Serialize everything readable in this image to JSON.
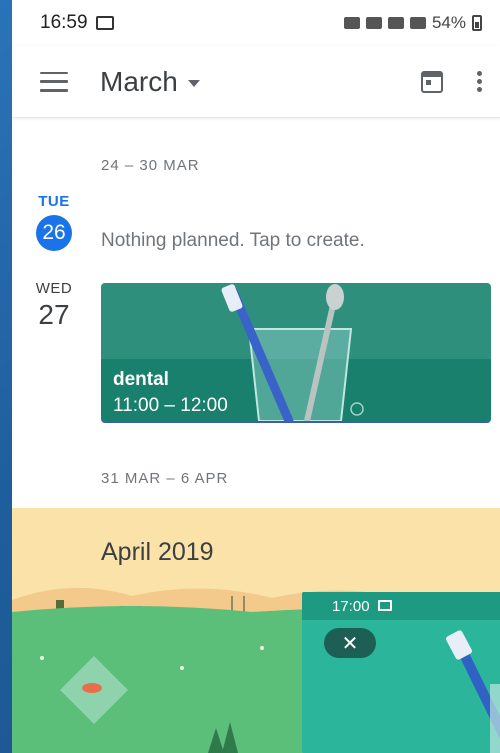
{
  "status_bar": {
    "time": "16:59",
    "battery": "54%"
  },
  "app_bar": {
    "month": "March"
  },
  "schedule": {
    "week1_label": "24 – 30 MAR",
    "days": [
      {
        "name": "TUE",
        "number": "26",
        "today": true,
        "message": "Nothing planned. Tap to create."
      },
      {
        "name": "WED",
        "number": "27",
        "today": false
      }
    ],
    "event": {
      "title": "dental",
      "time": "11:00 – 12:00"
    },
    "week2_label": "31 MAR – 6 APR"
  },
  "month_banner": {
    "title": "April 2019"
  },
  "mini_window": {
    "time": "17:00",
    "close_symbol": "✕"
  },
  "colors": {
    "accent": "#1a73e8",
    "event": "#18806c",
    "banner": "#fbe2a8"
  }
}
